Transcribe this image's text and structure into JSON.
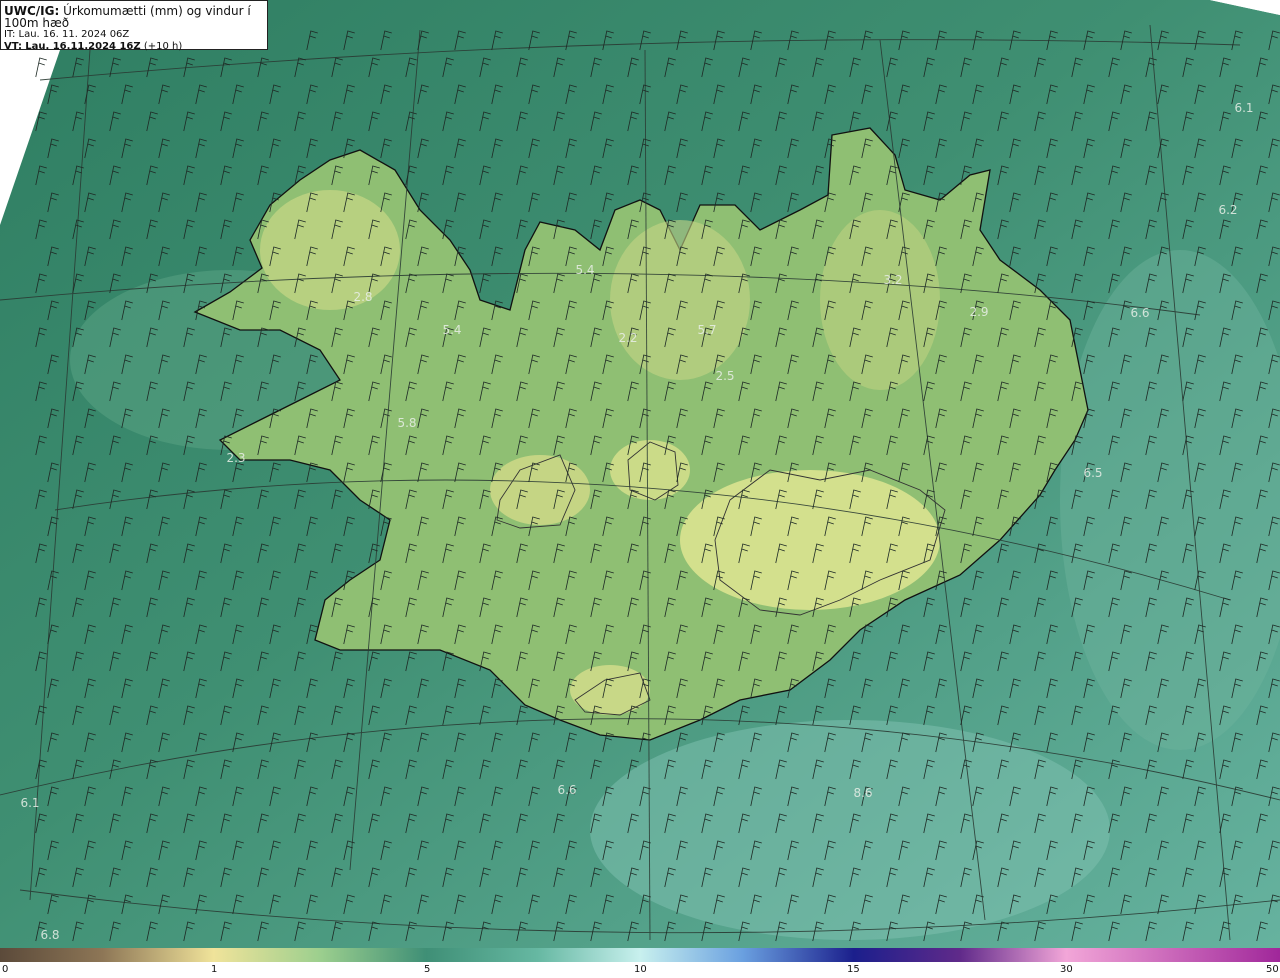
{
  "header": {
    "model_label": "UWC/IG:",
    "field_title": "Úrkomumætti (mm) og vindur í 100m hæð",
    "init_time": "IT: Lau. 16. 11. 2024 06Z",
    "valid_label": "VT:",
    "valid_time": "Lau. 16.11.2024 16Z",
    "lead_time": "(+10 h)"
  },
  "colorbar": {
    "ticks": [
      "0",
      "1",
      "5",
      "10",
      "15",
      "30",
      "50"
    ]
  },
  "map_values": [
    "6.1",
    "6.2",
    "5.4",
    "2.8",
    "5.4",
    "5.7",
    "3.2",
    "2.9",
    "6.6",
    "2.2",
    "2.5",
    "5.8",
    "2.3",
    "6.5",
    "6.6",
    "8.6",
    "6.1",
    "6.8"
  ],
  "colors": {
    "ocean": "#3f8f76",
    "land": "#c9d68a",
    "coast": "#111111"
  }
}
